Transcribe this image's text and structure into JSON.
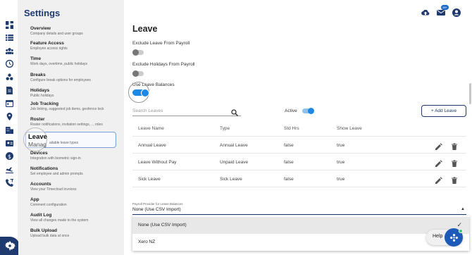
{
  "rail": {
    "icons": [
      "dashboard-icon",
      "list-icon",
      "people-icon",
      "clock-icon",
      "breaks-icon",
      "document-icon",
      "calendar-icon",
      "location-icon",
      "building-icon",
      "user-card-icon",
      "dollar-icon",
      "flight-icon",
      "phone-transfer-icon"
    ],
    "settings_icon": "gear-icon"
  },
  "settings": {
    "title": "Settings",
    "items": [
      {
        "title": "Overview",
        "desc": "Company details and user groups"
      },
      {
        "title": "Feature Access",
        "desc": "Employee access rights"
      },
      {
        "title": "Time",
        "desc": "Work days, overtime, public holidays"
      },
      {
        "title": "Breaks",
        "desc": "Configure break options for employees"
      },
      {
        "title": "Holidays",
        "desc": "Public holidays"
      },
      {
        "title": "Job Tracking",
        "desc": "Job linking, suggested job items, geofence lock"
      },
      {
        "title": "Roster",
        "desc": "Roster notifications, invitation settings, ... roles"
      },
      {
        "title": "Devices",
        "desc": "Integration with biometric sign-in"
      },
      {
        "title": "Notifications",
        "desc": "Set employee and admin prompts"
      },
      {
        "title": "Accounts",
        "desc": "View your Timecloud invoices"
      },
      {
        "title": "App",
        "desc": "Comment configuration"
      },
      {
        "title": "Audit Log",
        "desc": "View all changes made to the system"
      },
      {
        "title": "Bulk Upload",
        "desc": "Upload bulk data at once"
      }
    ],
    "selected": {
      "title": "Leave",
      "desc_zoom": "Manag",
      "desc_rest": "ailable leave types"
    }
  },
  "top": {
    "badge": "99+"
  },
  "leave": {
    "title": "Leave",
    "exclude_payroll_label": "Exclude Leave From Payroll",
    "exclude_holidays_label": "Exclude Holidays From Payroll",
    "use_balances_label": "Use Leave Balances",
    "search_placeholder": "Search Leaves",
    "active_label": "Active",
    "add_button": "+ Add Leave",
    "columns": [
      "Leave Name",
      "Type",
      "Std Hrs",
      "Show Leave"
    ],
    "rows": [
      {
        "name": "Annual Leave",
        "type": "Annual Leave",
        "std": "false",
        "show": "true"
      },
      {
        "name": "Leave Without Pay",
        "type": "Unpaid Leave",
        "std": "false",
        "show": "true"
      },
      {
        "name": "Sick Leave",
        "type": "Sick Leave",
        "std": "false",
        "show": "true"
      }
    ],
    "payroll_provider_label": "Payroll Provider for Leave Balances",
    "payroll_provider_value": "None (Use CSV Import)",
    "options": [
      "None (Use CSV Import)",
      "Xero NZ"
    ]
  },
  "help": {
    "label": "Help"
  }
}
